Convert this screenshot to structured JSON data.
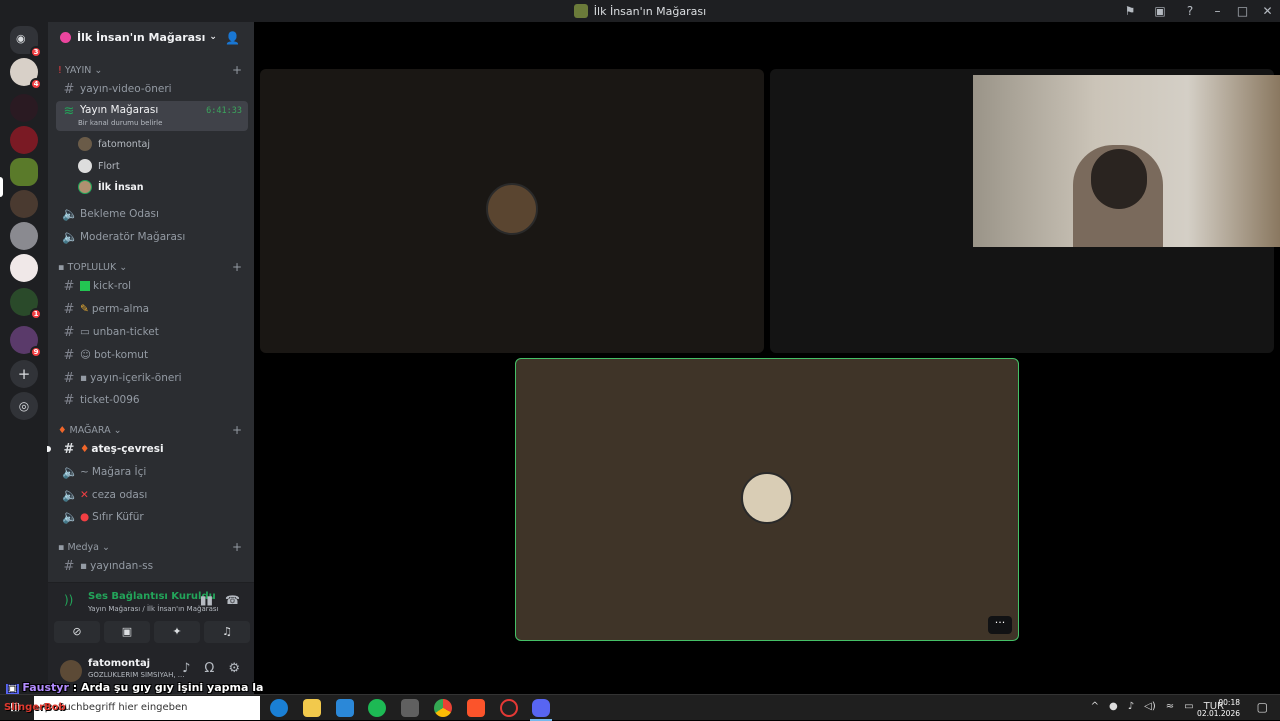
{
  "window": {
    "title": "İlk İnsan'ın Mağarası"
  },
  "servers": {
    "badges": [
      "3",
      "4",
      "1",
      "9"
    ]
  },
  "server": {
    "name": "İlk İnsan'ın Mağarası"
  },
  "categories": [
    {
      "name": "YAYIN"
    },
    {
      "name": "TOPLULUK"
    },
    {
      "name": "MAĞARA"
    },
    {
      "name": "Medya"
    }
  ],
  "channels": {
    "yayin_video_oneri": "yayın-video-öneri",
    "yayin_magarasi": "Yayın Mağarası",
    "yayin_timer": "6:41:33",
    "yayin_status": "Bir kanal durumu belirle",
    "voice_users": [
      "fatomontaj",
      "Flort",
      "İlk İnsan"
    ],
    "bekleme": "Bekleme Odası",
    "moderator": "Moderatör Mağarası",
    "kick_rol": "kick-rol",
    "perm_alma": "perm-alma",
    "unban_ticket": "unban-ticket",
    "bot_komut": "bot-komut",
    "yayin_icerik": "yayın-içerik-öneri",
    "ticket": "ticket-0096",
    "ates": "ateş-çevresi",
    "magara_ici": "Mağara İçi",
    "ceza": "ceza odası",
    "sifir_kufur": "Sıfır Küfür",
    "yayindan_ss": "yayından-ss"
  },
  "voice_panel": {
    "status": "Ses Bağlantısı Kuruldu",
    "location": "Yayın Mağarası / İlk İnsan'ın Mağarası"
  },
  "user": {
    "name": "fatomontaj",
    "status": "GÖZLÜKLERİM SİMSİYAH, ..."
  },
  "overlay": {
    "chat_nick": "Faustyr",
    "chat_text": " : Arda şu gıy gıy işini yapma la",
    "brand": "SlingerBob"
  },
  "taskbar": {
    "search_placeholder": "Suchbegriff hier eingeben",
    "lang": "TUR",
    "time": "00:18",
    "date": "02.01.2026"
  },
  "colors": {
    "accent_green": "#23a55a",
    "sidebar": "#2b2d31",
    "rail": "#1e1f22"
  }
}
